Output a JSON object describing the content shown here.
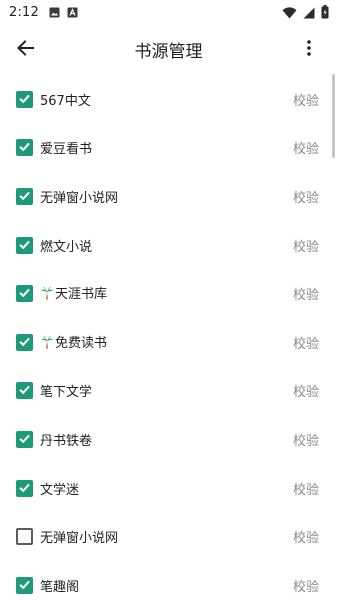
{
  "status_bar": {
    "time": "2:12",
    "left_icons": [
      "image-icon",
      "font-icon"
    ],
    "right_icons": [
      "wifi-icon",
      "cellular-icon",
      "battery-icon"
    ]
  },
  "app_bar": {
    "title": "书源管理",
    "back_icon": "arrow-left-icon",
    "more_icon": "more-vert-icon"
  },
  "colors": {
    "accent": "#1f9a78",
    "action_text": "#8a8a8a"
  },
  "sources": [
    {
      "name": "567中文",
      "checked": true,
      "action": "校验",
      "icon": ""
    },
    {
      "name": "爱豆看书",
      "checked": true,
      "action": "校验",
      "icon": ""
    },
    {
      "name": "无弹窗小说网",
      "checked": true,
      "action": "校验",
      "icon": ""
    },
    {
      "name": "燃文小说",
      "checked": true,
      "action": "校验",
      "icon": ""
    },
    {
      "name": "天涯书库",
      "checked": true,
      "action": "校验",
      "icon": "palm-tree-icon"
    },
    {
      "name": "免费读书",
      "checked": true,
      "action": "校验",
      "icon": "palm-tree-icon"
    },
    {
      "name": "笔下文学",
      "checked": true,
      "action": "校验",
      "icon": ""
    },
    {
      "name": "丹书铁卷",
      "checked": true,
      "action": "校验",
      "icon": ""
    },
    {
      "name": "文学迷",
      "checked": true,
      "action": "校验",
      "icon": ""
    },
    {
      "name": "无弹窗小说网",
      "checked": false,
      "action": "校验",
      "icon": ""
    },
    {
      "name": "笔趣阁",
      "checked": true,
      "action": "校验",
      "icon": ""
    }
  ]
}
